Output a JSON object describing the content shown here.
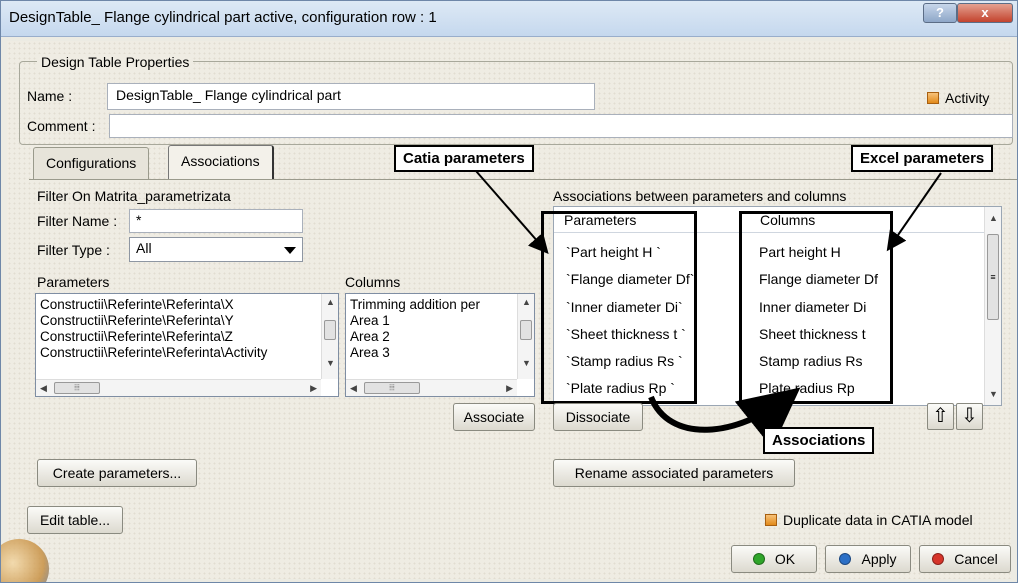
{
  "window": {
    "title": "DesignTable_ Flange cylindrical part active, configuration row : 1",
    "help_label": "?",
    "close_label": "x"
  },
  "properties": {
    "legend": "Design Table Properties",
    "name_label": "Name :",
    "name_value": "DesignTable_ Flange cylindrical part",
    "comment_label": "Comment :",
    "comment_value": "",
    "activity_label": "Activity"
  },
  "tabs": [
    {
      "label": "Configurations",
      "active": false
    },
    {
      "label": "Associations",
      "active": true
    }
  ],
  "filter": {
    "heading": "Filter On Matrita_parametrizata",
    "name_label": "Filter Name :",
    "name_value": "*",
    "type_label": "Filter Type :",
    "type_value": "All"
  },
  "parameters_list": {
    "heading": "Parameters",
    "items": [
      "Constructii\\Referinte\\Referinta\\X",
      "Constructii\\Referinte\\Referinta\\Y",
      "Constructii\\Referinte\\Referinta\\Z",
      "Constructii\\Referinte\\Referinta\\Activity"
    ]
  },
  "columns_list": {
    "heading": "Columns",
    "items": [
      "Trimming addition per",
      "Area 1",
      "Area 2",
      "Area 3"
    ]
  },
  "associations": {
    "heading": "Associations between parameters and columns",
    "col_parameters": "Parameters",
    "col_columns": "Columns",
    "rows": [
      {
        "parameter": "`Part height H `",
        "column": "Part height H"
      },
      {
        "parameter": "`Flange diameter Df`",
        "column": "Flange diameter Df"
      },
      {
        "parameter": "`Inner diameter Di`",
        "column": "Inner diameter Di"
      },
      {
        "parameter": "`Sheet thickness t `",
        "column": "Sheet thickness t"
      },
      {
        "parameter": "`Stamp radius Rs `",
        "column": "Stamp radius Rs"
      },
      {
        "parameter": "`Plate radius Rp `",
        "column": "Plate radius Rp"
      }
    ]
  },
  "buttons": {
    "associate": "Associate",
    "dissociate": "Dissociate",
    "create_parameters": "Create parameters...",
    "rename_associated": "Rename associated parameters",
    "edit_table": "Edit table...",
    "ok": "OK",
    "apply": "Apply",
    "cancel": "Cancel",
    "move_up": "⇧",
    "move_down": "⇩"
  },
  "duplicate_label": "Duplicate data in CATIA model",
  "annotations": {
    "catia_parameters": "Catia parameters",
    "excel_parameters": "Excel parameters",
    "associations": "Associations"
  },
  "colors": {
    "ok": "#2fa52a",
    "apply": "#2b6fc6",
    "cancel": "#d6342a",
    "check": "#e28a1a"
  }
}
